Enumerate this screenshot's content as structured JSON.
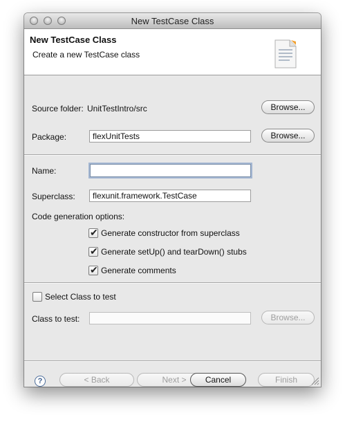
{
  "window": {
    "title": "New TestCase Class"
  },
  "banner": {
    "title": "New TestCase Class",
    "subtitle": "Create a new TestCase class",
    "icon": "document-icon"
  },
  "form": {
    "source_folder_label": "Source folder:",
    "source_folder_value": "UnitTestIntro/src",
    "package_label": "Package:",
    "package_value": "flexUnitTests",
    "name_label": "Name:",
    "name_value": "",
    "superclass_label": "Superclass:",
    "superclass_value": "flexunit.framework.TestCase",
    "options_label": "Code generation options:",
    "options": [
      {
        "label": "Generate constructor from superclass",
        "checked": true
      },
      {
        "label": "Generate setUp() and tearDown() stubs",
        "checked": true
      },
      {
        "label": "Generate comments",
        "checked": true
      }
    ],
    "select_class_label": "Select Class to test",
    "select_class_checked": false,
    "class_to_test_label": "Class to test:",
    "class_to_test_value": "",
    "browse_label": "Browse..."
  },
  "footer": {
    "help_label": "?",
    "back_label": "< Back",
    "next_label": "Next >",
    "cancel_label": "Cancel",
    "finish_label": "Finish"
  }
}
